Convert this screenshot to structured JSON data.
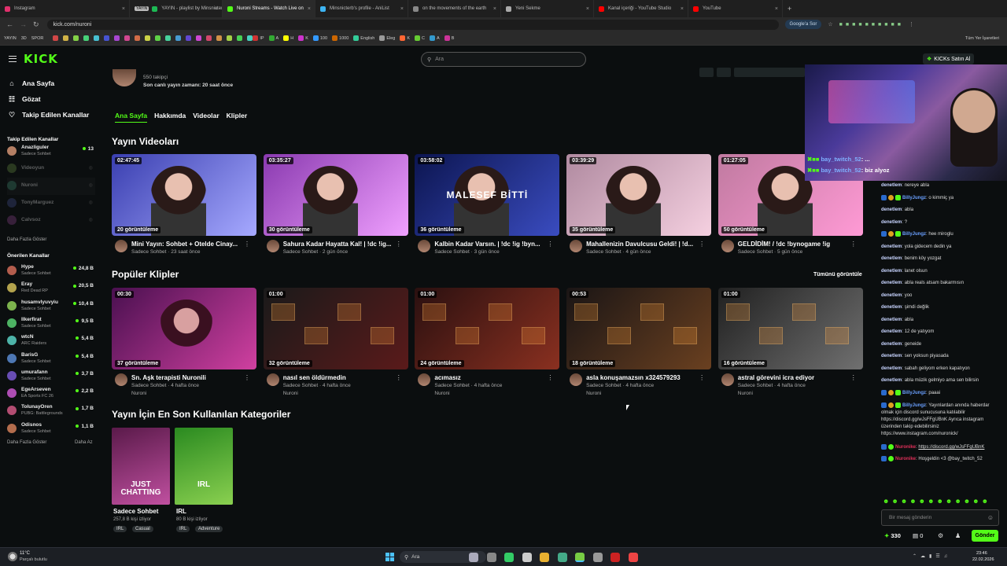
{
  "browser": {
    "tabs": [
      {
        "label": "Instagram",
        "color": "#e1306c"
      },
      {
        "label": "YAYIN - playlist by Minsnicterb",
        "color": "#1db954",
        "badge": "YAYIN"
      },
      {
        "label": "Nuroni Streams - Watch Live on",
        "color": "#53fc18"
      },
      {
        "label": "Minsnicterb's profile - AniList",
        "color": "#3db4f2"
      },
      {
        "label": "on the movements of the earth",
        "color": "#888888"
      },
      {
        "label": "Yeni Sekme",
        "color": "#aaaaaa"
      },
      {
        "label": "Kanal içeriği - YouTube Studio",
        "color": "#ff0000"
      },
      {
        "label": "YouTube",
        "color": "#ff0000"
      }
    ],
    "url": "kick.com/nuroni",
    "google_btn": "Google'a Sor",
    "bookmarks": [
      "YAYIN",
      "3D",
      "SPOR",
      "IP",
      "A",
      "H",
      "K",
      "100",
      "1000",
      "English",
      "Eleg",
      "K",
      "C",
      "A",
      "B"
    ],
    "all_bookmarks": "Tüm Yer İşaretleri"
  },
  "kick": {
    "logo": "KICK",
    "search_placeholder": "Ara",
    "buy_kicks": "KICKs Satın Al",
    "nav": [
      {
        "label": "Ana Sayfa",
        "icon": "home-icon"
      },
      {
        "label": "Gözat",
        "icon": "browse-icon"
      },
      {
        "label": "Takip Edilen Kanallar",
        "icon": "heart-icon"
      }
    ],
    "followed_title": "Takip Edilen Kanallar",
    "followed": [
      {
        "name": "Anazliguler",
        "game": "Sadece Sohbet",
        "viewers": "13",
        "live": true
      },
      {
        "name": "Videoyun",
        "game": "",
        "viewers": "",
        "live": false
      },
      {
        "name": "Nuroni",
        "game": "",
        "viewers": "",
        "live": false
      },
      {
        "name": "TonyMarguez",
        "game": "",
        "viewers": "",
        "live": false
      },
      {
        "name": "Calvsoz",
        "game": "",
        "viewers": "",
        "live": false
      }
    ],
    "more1": "Daha Fazla Göster",
    "recommended_title": "Önerilen Kanallar",
    "recommended": [
      {
        "name": "Hype",
        "game": "Sadece Sohbet",
        "viewers": "24,8 B"
      },
      {
        "name": "Eray",
        "game": "Red Dead RP",
        "viewers": "20,5 B"
      },
      {
        "name": "husamvlyuvyiu",
        "game": "Sadece Sohbet",
        "viewers": "10,4 B"
      },
      {
        "name": "llkerfirat",
        "game": "Sadece Sohbet",
        "viewers": "9,5 B"
      },
      {
        "name": "wtcN",
        "game": "ARC Raiders",
        "viewers": "5,4 B"
      },
      {
        "name": "BarisG",
        "game": "Sadece Sohbet",
        "viewers": "5,4 B"
      },
      {
        "name": "umurafann",
        "game": "Sadece Sohbet",
        "viewers": "3,7 B"
      },
      {
        "name": "EgeArseven",
        "game": "EA Sports FC 26",
        "viewers": "2,2 B"
      },
      {
        "name": "TolunayOren",
        "game": "PUBG: Battlegrounds",
        "viewers": "1,7 B"
      },
      {
        "name": "Odisnos",
        "game": "Sadece Sohbet",
        "viewers": "1,1 B"
      }
    ],
    "more2": "Daha Fazla Göster",
    "less": "Daha Az",
    "profile": {
      "followers": "550 takipçi",
      "last_live": "Son canlı yayın zamanı: 20 saat önce"
    },
    "tabs": [
      "Ana Sayfa",
      "Hakkımda",
      "Videolar",
      "Klipler"
    ],
    "videos_title": "Yayın Videoları",
    "videos": [
      {
        "dur": "02:47:45",
        "views": "20 görüntüleme",
        "title": "Mini Yayın: Sohbet + Otelde Cinay...",
        "meta": "Sadece Sohbet · 23 saat önce",
        "c1": "#3a3fb0",
        "c2": "#a6a9ff"
      },
      {
        "dur": "03:35:27",
        "views": "30 görüntüleme",
        "title": "Sahura Kadar Hayatta Kal! | !dc !ig...",
        "meta": "Sadece Sohbet · 2 gün önce",
        "c1": "#8a3ab0",
        "c2": "#f0a0ff"
      },
      {
        "dur": "03:58:02",
        "views": "36 görüntüleme",
        "title": "Kalbin Kadar Varsın. | !dc !ig !byn...",
        "meta": "Sadece Sohbet · 3 gün önce",
        "c1": "#0c1550",
        "c2": "#3a4cc0",
        "overlay": "MALESEF BİTTİ"
      },
      {
        "dur": "03:39:29",
        "views": "35 görüntüleme",
        "title": "Mahallenizin Davulcusu Geldi! | !d...",
        "meta": "Sadece Sohbet · 4 gün önce",
        "c1": "#b08aa0",
        "c2": "#f5d0e0"
      },
      {
        "dur": "01:27:05",
        "views": "50 görüntüleme",
        "title": "GELDİDİM! / !dc !bynogame !ig",
        "meta": "Sadece Sohbet · 5 gün önce",
        "c1": "#c07aa0",
        "c2": "#ff9ad5"
      }
    ],
    "clips_title": "Popüler Klipler",
    "see_all": "Tümünü görüntüle",
    "clips": [
      {
        "dur": "00:30",
        "views": "37 görüntüleme",
        "title": "Sn. Aşk terapisti Nuronili",
        "meta": "Sadece Sohbet · 4 hafta önce",
        "channel": "Nuroni",
        "c1": "#4a1050",
        "c2": "#d040a0"
      },
      {
        "dur": "01:00",
        "views": "32 görüntüleme",
        "title": "nasıl sen öldürmedin",
        "meta": "Sadece Sohbet · 4 hafta önce",
        "channel": "Nuroni",
        "c1": "#1a1a1a",
        "c2": "#5a1a1a"
      },
      {
        "dur": "01:00",
        "views": "24 görüntüleme",
        "title": "acımasız",
        "meta": "Sadece Sohbet · 4 hafta önce",
        "channel": "Nuroni",
        "c1": "#2a1010",
        "c2": "#8a3020"
      },
      {
        "dur": "00:53",
        "views": "18 görüntüleme",
        "title": "asla konuşamazsın x324579293",
        "meta": "Sadece Sohbet · 4 hafta önce",
        "channel": "Nuroni",
        "c1": "#1a1515",
        "c2": "#6a4020"
      },
      {
        "dur": "01:00",
        "views": "16 görüntüleme",
        "title": "astral görevini icra ediyor",
        "meta": "Sadece Sohbet · 4 hafta önce",
        "channel": "Nuroni",
        "c1": "#202020",
        "c2": "#707070"
      }
    ],
    "categories_title": "Yayın İçin En Son Kullanılan Kategoriler",
    "categories": [
      {
        "name": "Sadece Sohbet",
        "viewers": "257,8 B kişi izliyor",
        "tags": [
          "IRL",
          "Casual"
        ],
        "overlay": "JUST CHATTING",
        "c1": "#5a1a4a",
        "c2": "#c050a0"
      },
      {
        "name": "IRL",
        "viewers": "80 B kişi izliyor",
        "tags": [
          "IRL",
          "Adventure"
        ],
        "overlay": "IRL",
        "c1": "#2a8a20",
        "c2": "#8ad050"
      }
    ]
  },
  "chat": {
    "overlay_lines": [
      {
        "user": "bay_twitch_52",
        "text": ": ..."
      },
      {
        "user": "bay_twitch_52",
        "text": ": biz alyoz"
      }
    ],
    "messages": [
      {
        "user": "denetlem",
        "text": "nereye abla"
      },
      {
        "user": "BillyJungz",
        "text": "o kimmiç ya",
        "badges": true
      },
      {
        "user": "denetlem",
        "text": "abla"
      },
      {
        "user": "denetlem",
        "text": "?"
      },
      {
        "user": "BillyJungz",
        "text": "hee miroglu",
        "badges": true
      },
      {
        "user": "denetlem",
        "text": "yola gidecem dedin ya"
      },
      {
        "user": "denetlem",
        "text": "benim köy yozgat"
      },
      {
        "user": "denetlem",
        "text": "lanet olsun"
      },
      {
        "user": "denetlem",
        "text": "abla reals atsam bakarmısın"
      },
      {
        "user": "denetlem",
        "text": "yoo"
      },
      {
        "user": "denetlem",
        "text": "şimdi değlik"
      },
      {
        "user": "denetlem",
        "text": "abla"
      },
      {
        "user": "denetlem",
        "text": "12 de yatıyom"
      },
      {
        "user": "denetlem",
        "text": "geneide"
      },
      {
        "user": "denetlem",
        "text": "sen yoksun piyasada"
      },
      {
        "user": "denetlem",
        "text": "sabah geliyom erken kapatıyon"
      },
      {
        "user": "denetlem",
        "text": "abla müzik gelmiyo ama sen bilirsin"
      },
      {
        "user": "BillyJungz",
        "text": "paaai",
        "badges": true
      }
    ],
    "bot_msg": {
      "user": "BillyJungz",
      "text": "Yayınlardan anında haberdar olmak için discord sunucusuna katılabilir https://discord.gg/wJsFFgUBnK Ayrıca instagram üzerinden takip edebilirsiniz https://www.instagram.com/nuronick/"
    },
    "red_msgs": [
      {
        "user": "Nuronike",
        "text": "https://discord.gg/wJsFFgUBnK"
      },
      {
        "user": "Nuronike",
        "text": "Hoşgeldin <3 @bay_twitch_52"
      }
    ],
    "input_placeholder": "Bir mesaj gönderin",
    "points": "330",
    "zero": "0",
    "send": "Gönder"
  },
  "taskbar": {
    "weather_temp": "11°C",
    "weather_desc": "Parçalı bulutlu",
    "search": "Ara",
    "time": "23:46",
    "date": "22.02.2026"
  }
}
